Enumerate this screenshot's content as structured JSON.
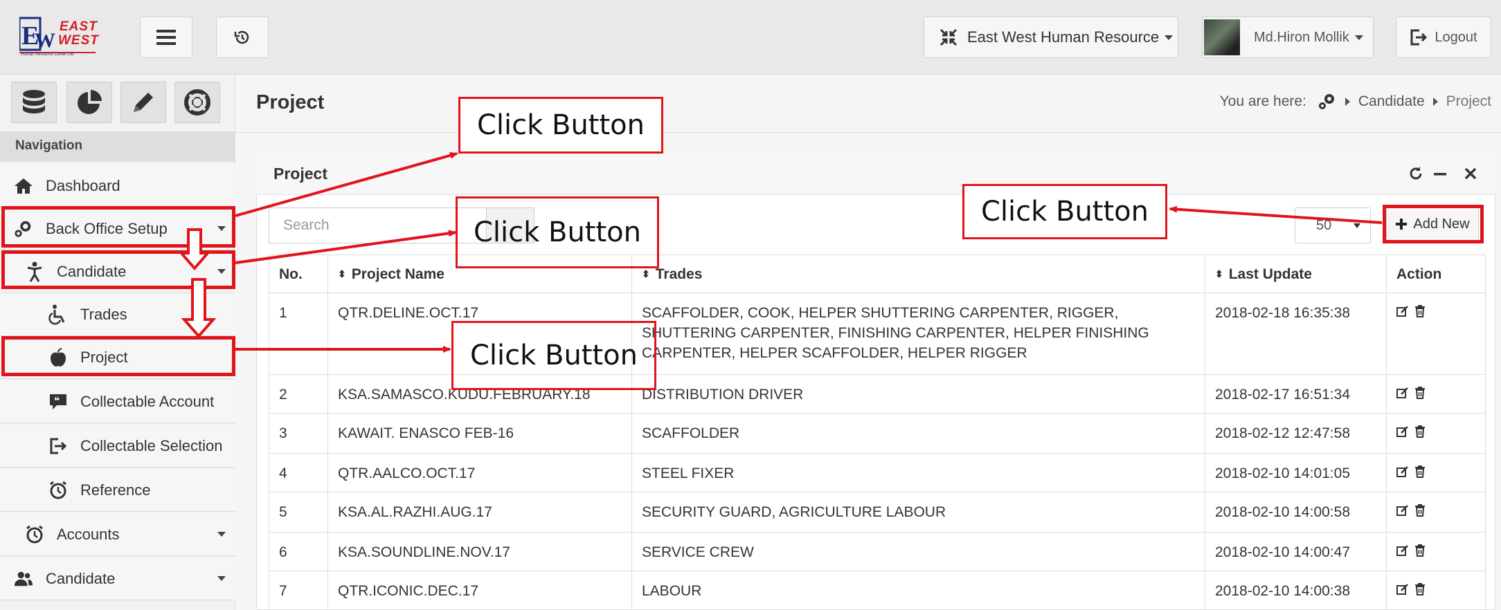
{
  "topbar": {
    "logo_line1": "EAST",
    "logo_line2": "WEST",
    "logo_sub": "Human Resource Center Ltd.",
    "company": "East West Human Resource",
    "user": "Md.Hiron Mollik",
    "logout": "Logout"
  },
  "sidebar": {
    "header": "Navigation",
    "items": [
      {
        "label": "Dashboard",
        "icon": "home-icon"
      },
      {
        "label": "Back Office Setup",
        "icon": "gears-icon"
      },
      {
        "label": "Candidate",
        "icon": "person-icon"
      },
      {
        "label": "Trades",
        "icon": "wheelchair-icon"
      },
      {
        "label": "Project",
        "icon": "apple-icon"
      },
      {
        "label": "Collectable Account",
        "icon": "quote-icon"
      },
      {
        "label": "Collectable Selection",
        "icon": "sign-out-icon"
      },
      {
        "label": "Reference",
        "icon": "clock-icon"
      },
      {
        "label": "Accounts",
        "icon": "clock-icon"
      },
      {
        "label": "Candidate",
        "icon": "users-icon"
      }
    ]
  },
  "page": {
    "title": "Project",
    "breadcrumb_prefix": "You are here:",
    "crumbs": [
      "Candidate",
      "Project"
    ]
  },
  "panel": {
    "title": "Project",
    "search_placeholder": "Search",
    "page_size": "50",
    "add_new": "Add New"
  },
  "table": {
    "headers": [
      "No.",
      "Project Name",
      "Trades",
      "Last Update",
      "Action"
    ],
    "rows": [
      {
        "no": "1",
        "name": "QTR.DELINE.OCT.17",
        "trades": "SCAFFOLDER, COOK, HELPER SHUTTERING CARPENTER, RIGGER, SHUTTERING CARPENTER, FINISHING CARPENTER, HELPER FINISHING CARPENTER, HELPER SCAFFOLDER, HELPER RIGGER",
        "updated": "2018-02-18 16:35:38"
      },
      {
        "no": "2",
        "name": "KSA.SAMASCO.KUDU.FEBRUARY.18",
        "trades": "DISTRIBUTION DRIVER",
        "updated": "2018-02-17 16:51:34"
      },
      {
        "no": "3",
        "name": "KAWAIT. ENASCO FEB-16",
        "trades": "SCAFFOLDER",
        "updated": "2018-02-12 12:47:58"
      },
      {
        "no": "4",
        "name": "QTR.AALCO.OCT.17",
        "trades": "STEEL FIXER",
        "updated": "2018-02-10 14:01:05"
      },
      {
        "no": "5",
        "name": "KSA.AL.RAZHI.AUG.17",
        "trades": "SECURITY GUARD, AGRICULTURE LABOUR",
        "updated": "2018-02-10 14:00:58"
      },
      {
        "no": "6",
        "name": "KSA.SOUNDLINE.NOV.17",
        "trades": "SERVICE CREW",
        "updated": "2018-02-10 14:00:47"
      },
      {
        "no": "7",
        "name": "QTR.ICONIC.DEC.17",
        "trades": "LABOUR",
        "updated": "2018-02-10 14:00:38"
      }
    ]
  },
  "annotations": {
    "callout": "Click Button",
    "color": "#e0151b"
  }
}
